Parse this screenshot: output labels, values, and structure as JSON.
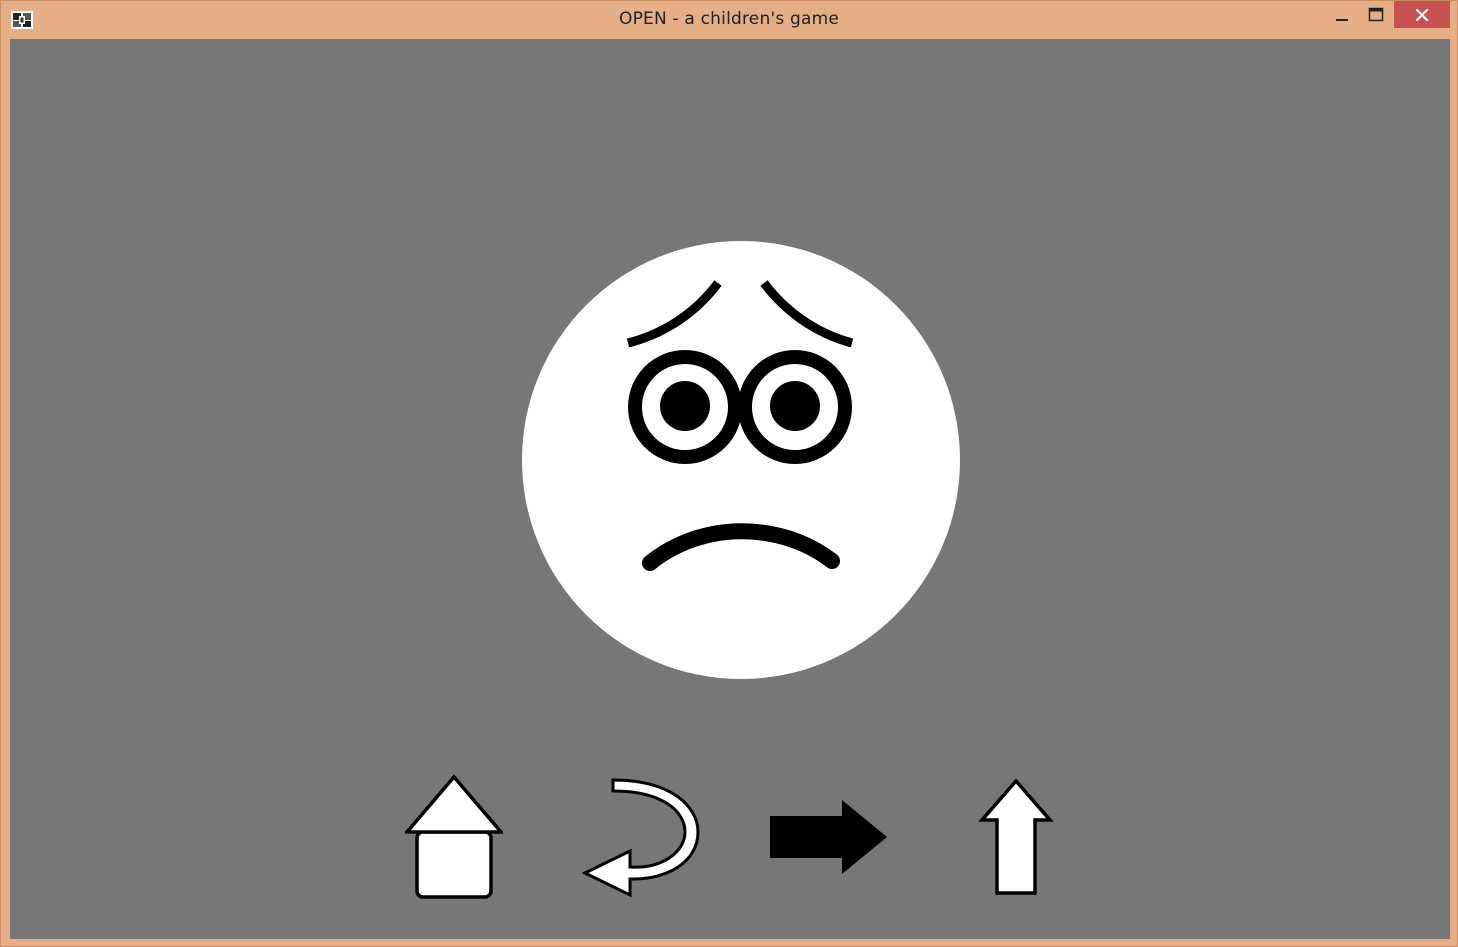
{
  "window": {
    "title": "OPEN - a children's game",
    "controls": {
      "minimize": "minimize-icon",
      "maximize": "maximize-icon",
      "close": "close-icon"
    },
    "frame_color": "#e5ae86",
    "close_color": "#c75050"
  },
  "game": {
    "background_color": "#777777",
    "face": {
      "icon": "sad-face-icon",
      "fill": "#ffffff",
      "feature_color": "#000000"
    },
    "nav": [
      {
        "icon": "home-icon",
        "fill": "#ffffff"
      },
      {
        "icon": "back-arrow-icon",
        "fill": "#ffffff"
      },
      {
        "icon": "next-arrow-icon",
        "fill": "#000000"
      },
      {
        "icon": "up-arrow-icon",
        "fill": "#ffffff"
      }
    ]
  }
}
